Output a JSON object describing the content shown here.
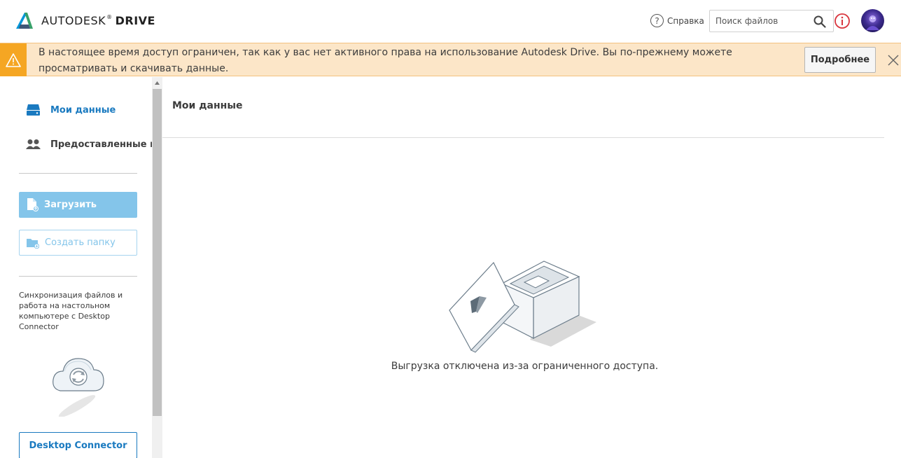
{
  "header": {
    "brand": "AUTODESK",
    "brand_reg": "®",
    "product": "DRIVE",
    "help_label": "Справка",
    "search_placeholder": "Поиск файлов",
    "icons": [
      "autodesk-logo-icon",
      "help-icon",
      "search-icon",
      "alert-circle-icon",
      "avatar"
    ]
  },
  "banner": {
    "message": "В настоящее время доступ ограничен, так как у вас нет активного права на использование Autodesk Drive. Вы по-прежнему можете просматривать и скачивать данные.",
    "more_button": "Подробнее",
    "icons": [
      "warning-icon",
      "close-icon"
    ]
  },
  "sidebar": {
    "nav": [
      {
        "label": "Мои данные",
        "icon": "drive-icon",
        "active": true
      },
      {
        "label": "Предоставленные мне",
        "icon": "people-icon",
        "active": false
      }
    ],
    "upload_button": "Загрузить",
    "create_folder_button": "Создать папку",
    "sync_text": "Синхронизация файлов и работа на настольном компьютере с Desktop Connector",
    "desktop_connector_button": "Desktop Connector"
  },
  "main": {
    "title": "Мои данные",
    "empty_message": "Выгрузка отключена из-за ограниченного доступа."
  },
  "colors": {
    "accent": "#1a7ac0",
    "upload_bg": "#84c5ea",
    "banner_bg": "#fce6c8",
    "banner_warn": "#f5a623"
  }
}
